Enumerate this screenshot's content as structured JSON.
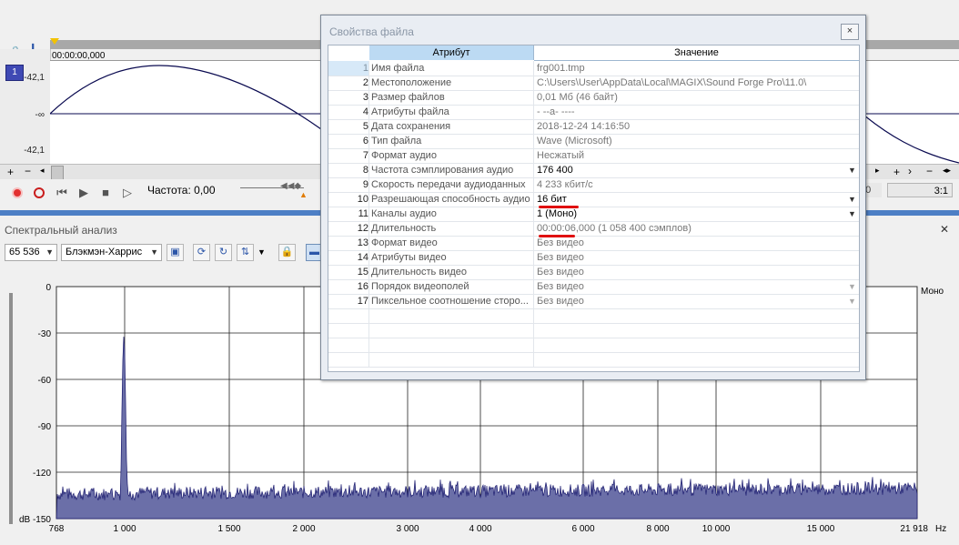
{
  "waveform": {
    "timecode": "00:00:00,000",
    "level_top": "-42,1",
    "level_mid": "-∞",
    "level_bottom": "-42,1",
    "channel_badge": "1"
  },
  "transport": {
    "rate_label": "Частота: 0,00",
    "right_field": "00",
    "zoom_ratio": "3:1"
  },
  "spectrum": {
    "panel_title": "Спектральный анализ",
    "fft_size": "65 536",
    "window_func": "Блэкмэн-Харрис",
    "channel_label": "Моно",
    "y_ticks": [
      "0",
      "-30",
      "-60",
      "-90",
      "-120",
      "dB -150"
    ],
    "x_ticks": [
      "768",
      "1 000",
      "1 500",
      "2 000",
      "3 000",
      "4 000",
      "6 000",
      "8 000",
      "10 000",
      "15 000",
      "21 918"
    ],
    "x_unit": "Hz"
  },
  "dialog": {
    "title": "Свойства файла",
    "close_glyph": "×",
    "col_attribute": "Атрибут",
    "col_value": "Значение",
    "rows": [
      {
        "n": "1",
        "attr": "Имя файла",
        "val": "frg001.tmp"
      },
      {
        "n": "2",
        "attr": "Местоположение",
        "val": "C:\\Users\\User\\AppData\\Local\\MAGIX\\Sound Forge Pro\\11.0\\"
      },
      {
        "n": "3",
        "attr": "Размер файлов",
        "val": "0,01 Мб (46 байт)"
      },
      {
        "n": "4",
        "attr": "Атрибуты файла",
        "val": "- --a- ----"
      },
      {
        "n": "5",
        "attr": "Дата сохранения",
        "val": "2018-12-24  14:16:50"
      },
      {
        "n": "6",
        "attr": "Тип файла",
        "val": "Wave (Microsoft)"
      },
      {
        "n": "7",
        "attr": "Формат аудио",
        "val": "Несжатый"
      },
      {
        "n": "8",
        "attr": "Частота сэмплирования аудио",
        "val": "176 400"
      },
      {
        "n": "9",
        "attr": "Скорость передачи аудиоданных",
        "val": "4 233 кбит/с"
      },
      {
        "n": "10",
        "attr": "Разрешающая способность аудио",
        "val": "16 бит"
      },
      {
        "n": "11",
        "attr": "Каналы аудио",
        "val": "1  (Моно)"
      },
      {
        "n": "12",
        "attr": "Длительность",
        "val": "00:00:06,000 (1 058 400 сэмплов)"
      },
      {
        "n": "13",
        "attr": "Формат видео",
        "val": "Без видео"
      },
      {
        "n": "14",
        "attr": "Атрибуты видео",
        "val": "Без видео"
      },
      {
        "n": "15",
        "attr": "Длительность видео",
        "val": "Без видео"
      },
      {
        "n": "16",
        "attr": "Порядок видеополей",
        "val": "Без видео"
      },
      {
        "n": "17",
        "attr": "Пиксельное соотношение сторо...",
        "val": "Без видео"
      }
    ]
  },
  "colors": {
    "spectrum_fill": "#6b6fa8",
    "spectrum_line": "#1a1a6e",
    "waveform": "#0a0a50",
    "annotation_red": "#e01010",
    "divider_blue": "#4d7fc5"
  }
}
